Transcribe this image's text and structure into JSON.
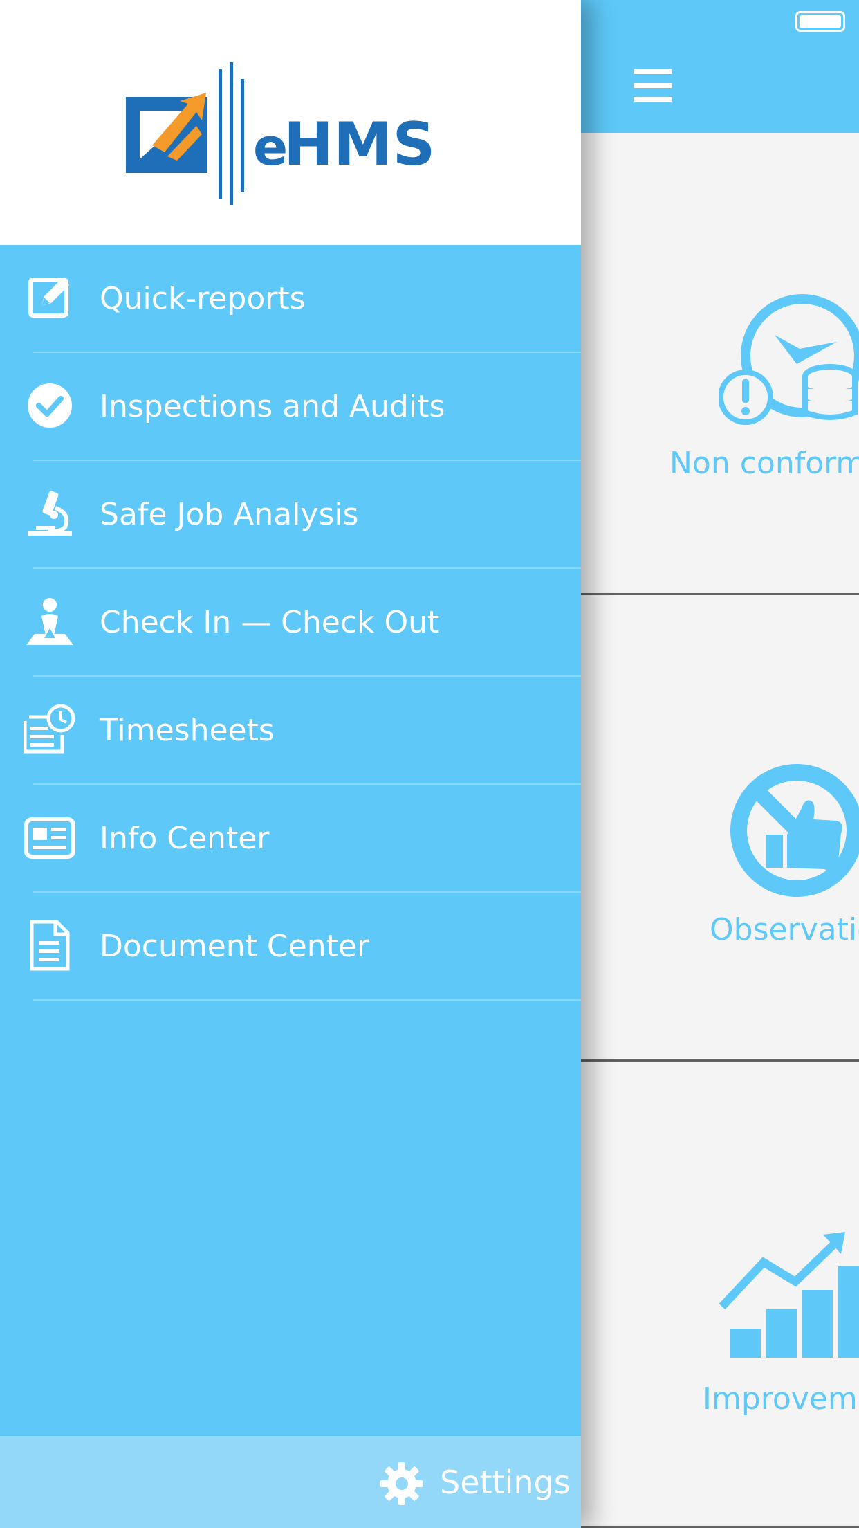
{
  "brand": {
    "logo_text": "eHMS",
    "logo_text_prefix": "e",
    "logo_text_suffix": "HMS"
  },
  "colors": {
    "drawer_bg": "#5ec8f8",
    "settings_bg": "#93d8f9",
    "logo_blue": "#1e6fb8",
    "logo_orange": "#f39a2b",
    "card_bg": "#f4f4f4",
    "card_accent": "#5ec8f8"
  },
  "drawer": {
    "items": [
      {
        "label": "Quick-reports",
        "icon": "edit-icon"
      },
      {
        "label": "Inspections and Audits",
        "icon": "check-circle-icon"
      },
      {
        "label": "Safe Job Analysis",
        "icon": "microscope-icon"
      },
      {
        "label": "Check In — Check Out",
        "icon": "map-pin-person-icon"
      },
      {
        "label": "Timesheets",
        "icon": "timesheet-clock-icon"
      },
      {
        "label": "Info Center",
        "icon": "news-icon"
      },
      {
        "label": "Document Center",
        "icon": "document-icon"
      }
    ],
    "settings": {
      "label": "Settings",
      "icon": "gear-icon"
    }
  },
  "main": {
    "header": {
      "menu_icon": "hamburger-icon",
      "status_icon": "battery-icon"
    },
    "cards": [
      {
        "label": "Non conforma",
        "icon": "clock-coins-alert-icon"
      },
      {
        "label": "Observatio",
        "icon": "no-thumbs-up-icon"
      },
      {
        "label": "Improveme",
        "icon": "growth-chart-icon"
      }
    ]
  }
}
